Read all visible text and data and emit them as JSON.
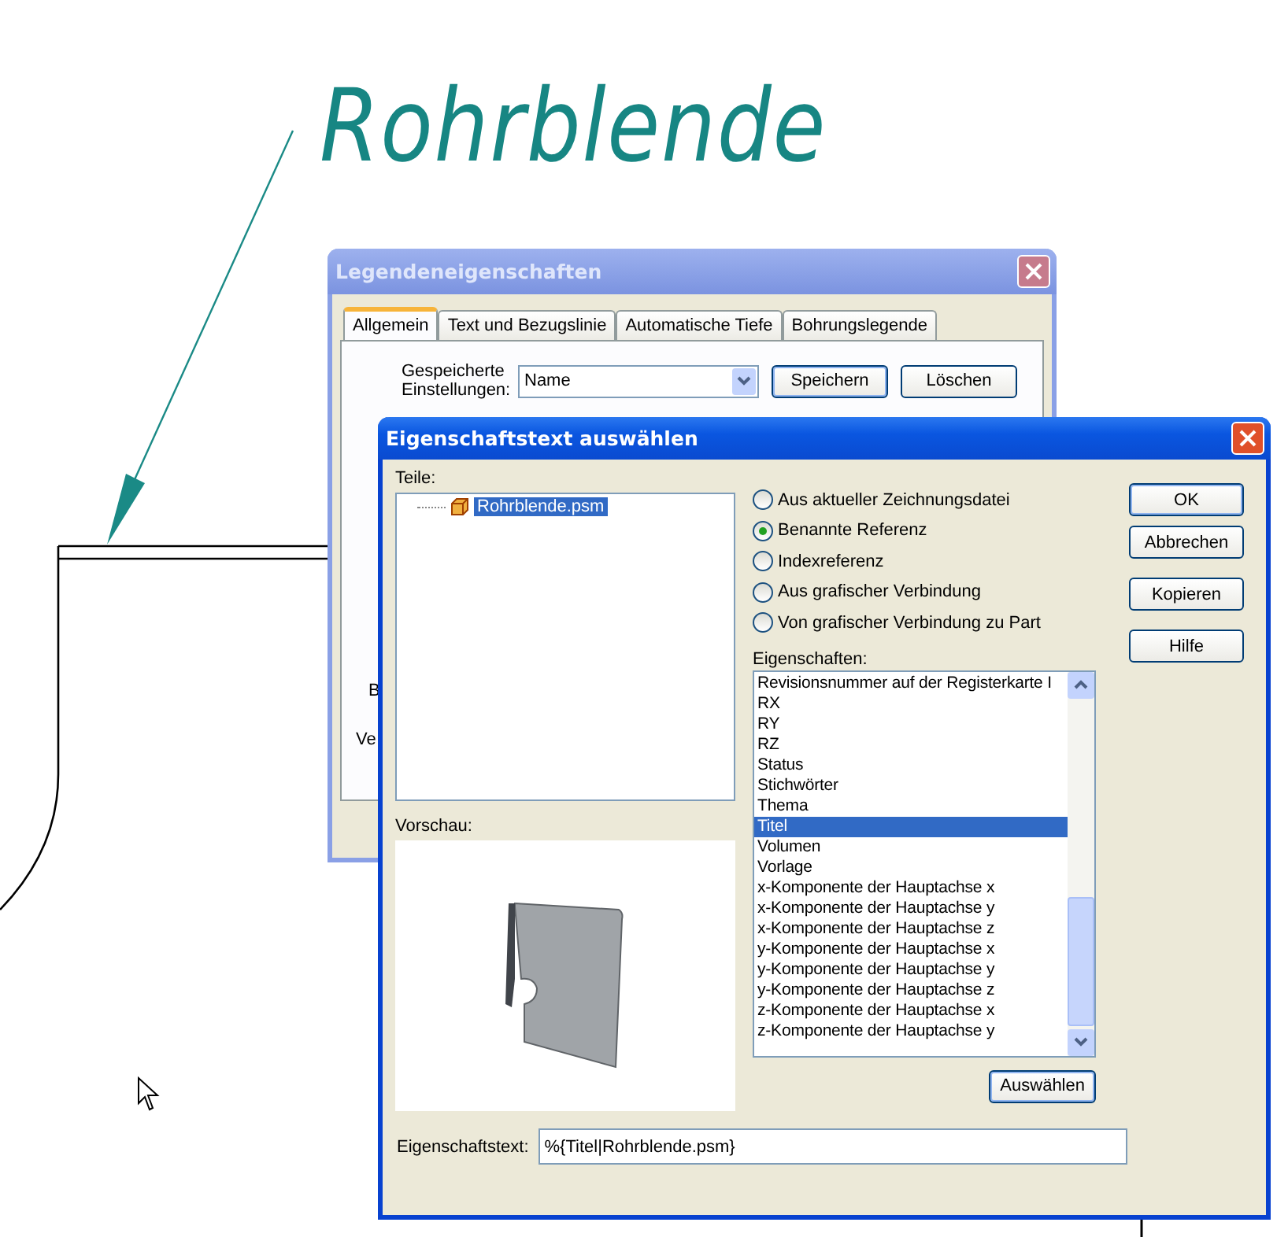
{
  "drawing": {
    "title": "Rohrblende"
  },
  "back_dialog": {
    "title": "Legendeneigenschaften",
    "tabs": [
      {
        "label": "Allgemein",
        "selected": true
      },
      {
        "label": "Text und Bezugslinie",
        "selected": false
      },
      {
        "label": "Automatische Tiefe",
        "selected": false
      },
      {
        "label": "Bohrungslegende",
        "selected": false
      }
    ],
    "saved_settings_label": "Gespeicherte Einstellungen:",
    "saved_settings_value": "Name",
    "buttons": [
      {
        "label": "Speichern",
        "default": true
      },
      {
        "label": "Löschen",
        "default": false
      }
    ],
    "cut_labels": [
      "B",
      "Ve"
    ]
  },
  "dialog": {
    "title": "Eigenschaftstext auswählen",
    "parts_label": "Teile:",
    "tree": [
      {
        "label": "Rohrblende.psm",
        "selected": true
      }
    ],
    "preview_label": "Vorschau:",
    "options": [
      {
        "label": "Aus aktueller Zeichnungsdatei",
        "selected": false
      },
      {
        "label": "Benannte Referenz",
        "selected": true
      },
      {
        "label": "Indexreferenz",
        "selected": false
      },
      {
        "label": "Aus grafischer Verbindung",
        "selected": false
      },
      {
        "label": "Von grafischer Verbindung zu Part",
        "selected": false
      }
    ],
    "properties_label": "Eigenschaften:",
    "properties": [
      {
        "label": "Revisionsnummer auf der Registerkarte I",
        "selected": false
      },
      {
        "label": "RX",
        "selected": false
      },
      {
        "label": "RY",
        "selected": false
      },
      {
        "label": "RZ",
        "selected": false
      },
      {
        "label": "Status",
        "selected": false
      },
      {
        "label": "Stichwörter",
        "selected": false
      },
      {
        "label": "Thema",
        "selected": false
      },
      {
        "label": "Titel",
        "selected": true
      },
      {
        "label": "Volumen",
        "selected": false
      },
      {
        "label": "Vorlage",
        "selected": false
      },
      {
        "label": "x-Komponente der Hauptachse x",
        "selected": false
      },
      {
        "label": "x-Komponente der Hauptachse y",
        "selected": false
      },
      {
        "label": "x-Komponente der Hauptachse z",
        "selected": false
      },
      {
        "label": "y-Komponente der Hauptachse x",
        "selected": false
      },
      {
        "label": "y-Komponente der Hauptachse y",
        "selected": false
      },
      {
        "label": "y-Komponente der Hauptachse z",
        "selected": false
      },
      {
        "label": "z-Komponente der Hauptachse x",
        "selected": false
      },
      {
        "label": "z-Komponente der Hauptachse y",
        "selected": false
      }
    ],
    "select_button": "Auswählen",
    "buttons": [
      {
        "label": "OK",
        "default": true
      },
      {
        "label": "Abbrechen",
        "default": false
      },
      {
        "label": "Kopieren",
        "default": false
      },
      {
        "label": "Hilfe",
        "default": false
      }
    ],
    "property_text_label": "Eigenschaftstext:",
    "property_text_value": "%{Titel|Rohrblende.psm}"
  }
}
